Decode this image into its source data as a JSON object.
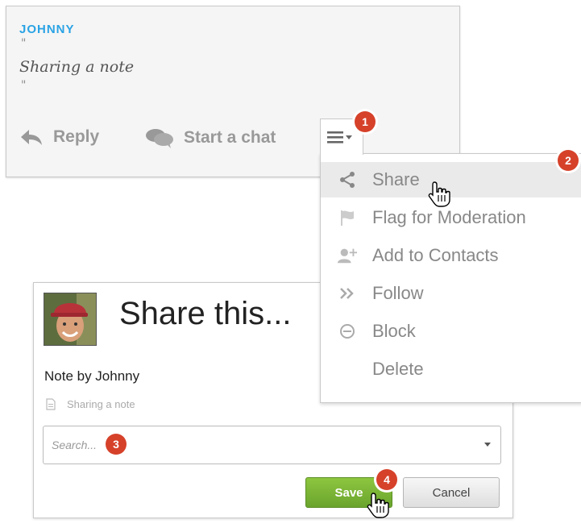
{
  "note": {
    "author": "JOHNNY",
    "open_quote": "\"",
    "text": "Sharing a note",
    "close_quote": "\"",
    "actions": {
      "reply": "Reply",
      "chat": "Start a chat"
    }
  },
  "menu": {
    "trigger_icon": "hamburger-chevron-icon",
    "items": [
      {
        "label": "Share",
        "icon": "share-icon",
        "active": true
      },
      {
        "label": "Flag for Moderation",
        "icon": "flag-icon"
      },
      {
        "label": "Add to Contacts",
        "icon": "add-contact-icon"
      },
      {
        "label": "Follow",
        "icon": "double-chevron-icon"
      },
      {
        "label": "Block",
        "icon": "block-icon"
      },
      {
        "label": "Delete",
        "icon": ""
      }
    ]
  },
  "share_panel": {
    "title": "Share this...",
    "note_by": "Note by Johnny",
    "note_preview": "Sharing a note",
    "search": {
      "placeholder": "Search...",
      "value": ""
    },
    "save_label": "Save",
    "cancel_label": "Cancel"
  },
  "badges": [
    "1",
    "2",
    "3",
    "4"
  ],
  "colors": {
    "author": "#2aa3e5",
    "badge": "#d6412a",
    "save_button": "#7ab536",
    "menu_active": "#eaeaea"
  }
}
